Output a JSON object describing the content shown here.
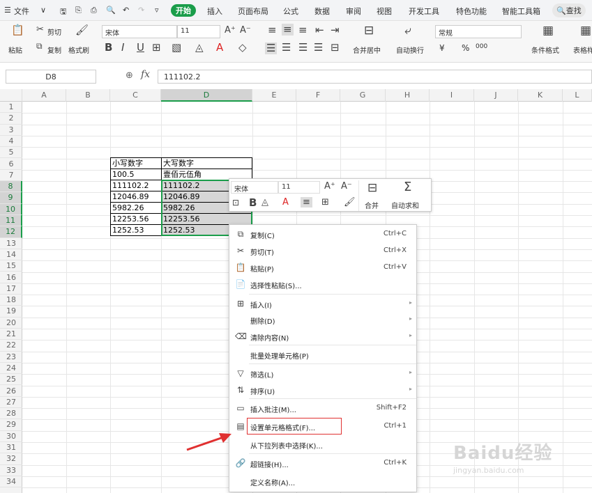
{
  "menubar": {
    "items": [
      "文件",
      "开始",
      "插入",
      "页面布局",
      "公式",
      "数据",
      "审阅",
      "视图",
      "开发工具",
      "特色功能",
      "智能工具箱"
    ],
    "search": "查找"
  },
  "ribbon": {
    "paste": "粘贴",
    "cut": "剪切",
    "copy": "复制",
    "format_painter": "格式刷",
    "font_name": "宋体",
    "font_size": "11",
    "merge_center": "合并居中",
    "auto_wrap": "自动换行",
    "number_format": "常规",
    "currency": "¥",
    "percent": "%",
    "thousands": "000",
    "conditional_format": "条件格式",
    "table_style": "表格样"
  },
  "formula_bar": {
    "cell_ref": "D8",
    "fx": "fx",
    "value": "111102.2"
  },
  "columns": [
    "A",
    "B",
    "C",
    "D",
    "E",
    "F",
    "G",
    "H",
    "I",
    "J",
    "K",
    "L"
  ],
  "rows": [
    "1",
    "2",
    "3",
    "4",
    "5",
    "6",
    "7",
    "8",
    "9",
    "10",
    "11",
    "12",
    "13",
    "14",
    "15",
    "16",
    "17",
    "18",
    "19",
    "20",
    "21",
    "22",
    "23",
    "24",
    "25",
    "26",
    "27",
    "28",
    "29",
    "30",
    "31",
    "32",
    "33",
    "34"
  ],
  "table": {
    "header_c": "小写数字",
    "header_d": "大写数字",
    "rows": [
      {
        "c": "100.5",
        "d": "壹佰元伍角"
      },
      {
        "c": "111102.2",
        "d": "111102.2"
      },
      {
        "c": "12046.89",
        "d": "12046.89"
      },
      {
        "c": "5982.26",
        "d": "5982.26"
      },
      {
        "c": "12253.56",
        "d": "12253.56"
      },
      {
        "c": "1252.53",
        "d": "1252.53"
      }
    ]
  },
  "mini_toolbar": {
    "font": "宋体",
    "size": "11",
    "bold": "B",
    "merge": "合并",
    "autosum": "自动求和"
  },
  "context_menu": [
    {
      "label": "复制(C)",
      "shortcut": "Ctrl+C",
      "icon": "copy-icon",
      "glyph": "⧉"
    },
    {
      "label": "剪切(T)",
      "shortcut": "Ctrl+X",
      "icon": "scissors-icon",
      "glyph": "✂"
    },
    {
      "label": "粘贴(P)",
      "shortcut": "Ctrl+V",
      "icon": "clipboard-icon",
      "glyph": "📋"
    },
    {
      "label": "选择性粘贴(S)...",
      "shortcut": "",
      "icon": "paste-special-icon",
      "glyph": "📄"
    },
    {
      "label": "插入(I)",
      "shortcut": "",
      "icon": "insert-icon",
      "glyph": "⊞",
      "arrow": true
    },
    {
      "label": "删除(D)",
      "shortcut": "",
      "icon": "",
      "glyph": "",
      "arrow": true
    },
    {
      "label": "清除内容(N)",
      "shortcut": "",
      "icon": "eraser-icon",
      "glyph": "⌫",
      "arrow": true
    },
    {
      "label": "批量处理单元格(P)",
      "shortcut": "",
      "icon": "",
      "glyph": ""
    },
    {
      "label": "筛选(L)",
      "shortcut": "",
      "icon": "filter-icon",
      "glyph": "▽",
      "arrow": true
    },
    {
      "label": "排序(U)",
      "shortcut": "",
      "icon": "sort-icon",
      "glyph": "⇅",
      "arrow": true
    },
    {
      "label": "插入批注(M)...",
      "shortcut": "Shift+F2",
      "icon": "comment-icon",
      "glyph": "▭"
    },
    {
      "label": "设置单元格格式(F)...",
      "shortcut": "Ctrl+1",
      "icon": "format-cells-icon",
      "glyph": "▤"
    },
    {
      "label": "从下拉列表中选择(K)...",
      "shortcut": "",
      "icon": "",
      "glyph": ""
    },
    {
      "label": "超链接(H)...",
      "shortcut": "Ctrl+K",
      "icon": "link-icon",
      "glyph": "🔗"
    },
    {
      "label": "定义名称(A)...",
      "shortcut": "",
      "icon": "",
      "glyph": ""
    }
  ],
  "watermark": {
    "brand": "Baidu经验",
    "url": "jingyan.baidu.com"
  },
  "colors": {
    "accent": "#1a9d4a",
    "highlight_box": "#e03030",
    "arrow": "#e03030"
  }
}
